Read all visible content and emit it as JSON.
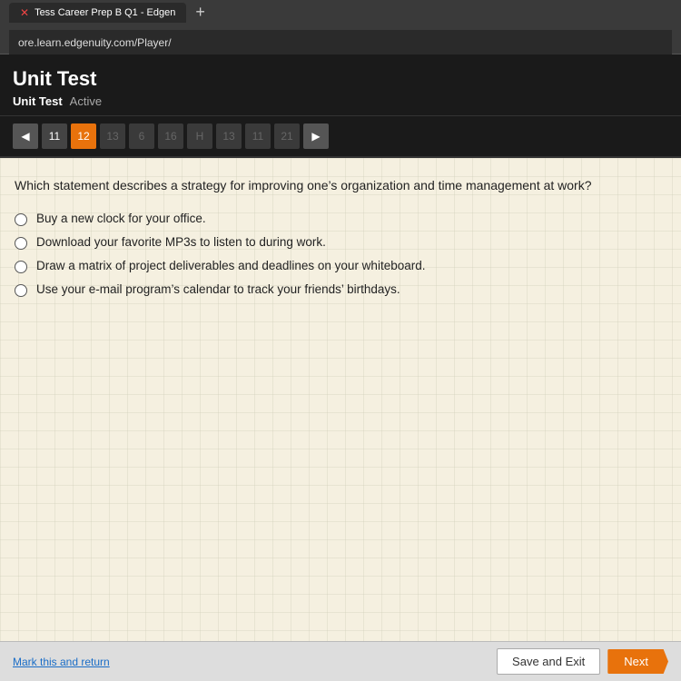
{
  "browser": {
    "address": "ore.learn.edgenuity.com/Player/",
    "tabs": [
      {
        "label": "Tess Career Prep B Q1 - Edgen",
        "active": true
      }
    ],
    "new_tab_label": "+"
  },
  "header": {
    "title": "Unit Test",
    "breadcrumb_item": "Unit Test",
    "breadcrumb_status": "Active"
  },
  "navigation": {
    "prev_arrow": "◀",
    "next_arrow": "▶",
    "buttons": [
      {
        "number": "11",
        "active": false
      },
      {
        "number": "12",
        "active": true
      },
      {
        "number": "13",
        "active": false,
        "disabled": true
      },
      {
        "number": "6",
        "active": false,
        "disabled": true
      },
      {
        "number": "16",
        "active": false,
        "disabled": true
      },
      {
        "number": "H",
        "active": false,
        "disabled": true
      },
      {
        "number": "13",
        "active": false,
        "disabled": true
      },
      {
        "number": "11",
        "active": false,
        "disabled": true
      },
      {
        "number": "21",
        "active": false,
        "disabled": true
      }
    ]
  },
  "question": {
    "text": "Which statement describes a strategy for improving one’s organization and time management at work?",
    "options": [
      {
        "id": "A",
        "text": "Buy a new clock for your office."
      },
      {
        "id": "B",
        "text": "Download your favorite MP3s to listen to during work."
      },
      {
        "id": "C",
        "text": "Draw a matrix of project deliverables and deadlines on your whiteboard."
      },
      {
        "id": "D",
        "text": "Use your e-mail program’s calendar to track your friends’ birthdays."
      }
    ]
  },
  "footer": {
    "mark_return_label": "Mark this and return",
    "save_exit_label": "Save and Exit",
    "next_label": "Next"
  }
}
